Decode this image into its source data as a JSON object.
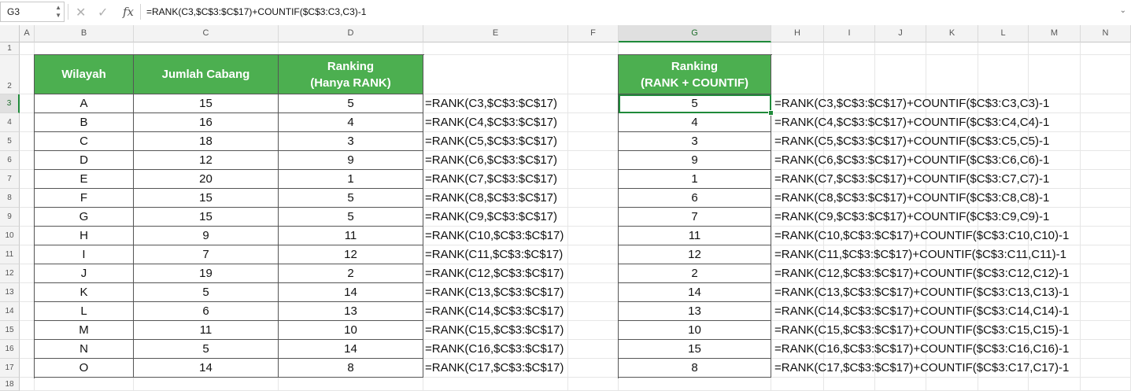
{
  "namebox": "G3",
  "formula": "=RANK(C3,$C$3:$C$17)+COUNTIF($C$3:C3,C3)-1",
  "columns": [
    "A",
    "B",
    "C",
    "D",
    "E",
    "F",
    "G",
    "H",
    "I",
    "J",
    "K",
    "L",
    "M",
    "N"
  ],
  "rows": [
    "1",
    "2",
    "3",
    "4",
    "5",
    "6",
    "7",
    "8",
    "9",
    "10",
    "11",
    "12",
    "13",
    "14",
    "15",
    "16",
    "17",
    "18"
  ],
  "selected_cell": "G3",
  "headers": {
    "wilayah": "Wilayah",
    "jumlah": "Jumlah Cabang",
    "rank1_line1": "Ranking",
    "rank1_line2": "(Hanya RANK)",
    "rank2_line1": "Ranking",
    "rank2_line2": "(RANK + COUNTIF)"
  },
  "table": [
    {
      "wilayah": "A",
      "jumlah": "15",
      "rank": "5",
      "f1": "=RANK(C3,$C$3:$C$17)",
      "rank2": "5",
      "f2": "=RANK(C3,$C$3:$C$17)+COUNTIF($C$3:C3,C3)-1"
    },
    {
      "wilayah": "B",
      "jumlah": "16",
      "rank": "4",
      "f1": "=RANK(C4,$C$3:$C$17)",
      "rank2": "4",
      "f2": "=RANK(C4,$C$3:$C$17)+COUNTIF($C$3:C4,C4)-1"
    },
    {
      "wilayah": "C",
      "jumlah": "18",
      "rank": "3",
      "f1": "=RANK(C5,$C$3:$C$17)",
      "rank2": "3",
      "f2": "=RANK(C5,$C$3:$C$17)+COUNTIF($C$3:C5,C5)-1"
    },
    {
      "wilayah": "D",
      "jumlah": "12",
      "rank": "9",
      "f1": "=RANK(C6,$C$3:$C$17)",
      "rank2": "9",
      "f2": "=RANK(C6,$C$3:$C$17)+COUNTIF($C$3:C6,C6)-1"
    },
    {
      "wilayah": "E",
      "jumlah": "20",
      "rank": "1",
      "f1": "=RANK(C7,$C$3:$C$17)",
      "rank2": "1",
      "f2": "=RANK(C7,$C$3:$C$17)+COUNTIF($C$3:C7,C7)-1"
    },
    {
      "wilayah": "F",
      "jumlah": "15",
      "rank": "5",
      "f1": "=RANK(C8,$C$3:$C$17)",
      "rank2": "6",
      "f2": "=RANK(C8,$C$3:$C$17)+COUNTIF($C$3:C8,C8)-1"
    },
    {
      "wilayah": "G",
      "jumlah": "15",
      "rank": "5",
      "f1": "=RANK(C9,$C$3:$C$17)",
      "rank2": "7",
      "f2": "=RANK(C9,$C$3:$C$17)+COUNTIF($C$3:C9,C9)-1"
    },
    {
      "wilayah": "H",
      "jumlah": "9",
      "rank": "11",
      "f1": "=RANK(C10,$C$3:$C$17)",
      "rank2": "11",
      "f2": "=RANK(C10,$C$3:$C$17)+COUNTIF($C$3:C10,C10)-1"
    },
    {
      "wilayah": "I",
      "jumlah": "7",
      "rank": "12",
      "f1": "=RANK(C11,$C$3:$C$17)",
      "rank2": "12",
      "f2": "=RANK(C11,$C$3:$C$17)+COUNTIF($C$3:C11,C11)-1"
    },
    {
      "wilayah": "J",
      "jumlah": "19",
      "rank": "2",
      "f1": "=RANK(C12,$C$3:$C$17)",
      "rank2": "2",
      "f2": "=RANK(C12,$C$3:$C$17)+COUNTIF($C$3:C12,C12)-1"
    },
    {
      "wilayah": "K",
      "jumlah": "5",
      "rank": "14",
      "f1": "=RANK(C13,$C$3:$C$17)",
      "rank2": "14",
      "f2": "=RANK(C13,$C$3:$C$17)+COUNTIF($C$3:C13,C13)-1"
    },
    {
      "wilayah": "L",
      "jumlah": "6",
      "rank": "13",
      "f1": "=RANK(C14,$C$3:$C$17)",
      "rank2": "13",
      "f2": "=RANK(C14,$C$3:$C$17)+COUNTIF($C$3:C14,C14)-1"
    },
    {
      "wilayah": "M",
      "jumlah": "11",
      "rank": "10",
      "f1": "=RANK(C15,$C$3:$C$17)",
      "rank2": "10",
      "f2": "=RANK(C15,$C$3:$C$17)+COUNTIF($C$3:C15,C15)-1"
    },
    {
      "wilayah": "N",
      "jumlah": "5",
      "rank": "14",
      "f1": "=RANK(C16,$C$3:$C$17)",
      "rank2": "15",
      "f2": "=RANK(C16,$C$3:$C$17)+COUNTIF($C$3:C16,C16)-1"
    },
    {
      "wilayah": "O",
      "jumlah": "14",
      "rank": "8",
      "f1": "=RANK(C17,$C$3:$C$17)",
      "rank2": "8",
      "f2": "=RANK(C17,$C$3:$C$17)+COUNTIF($C$3:C17,C17)-1"
    }
  ],
  "colors": {
    "header_green": "#4caf50",
    "selection_green": "#1f8a3a"
  }
}
